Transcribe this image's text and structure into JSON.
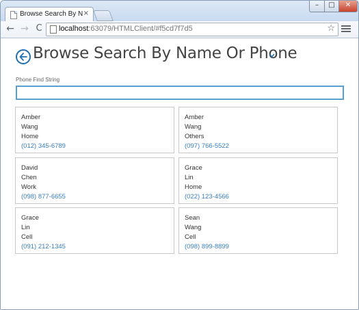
{
  "browser": {
    "tab_title": "Browse Search By Name O",
    "tab_close": "×",
    "url_host": "localhost",
    "url_path": ":63079/HTMLClient/#f5cd7f7d5",
    "window_buttons": {
      "minimize": "–",
      "maximize": "□",
      "close": "✕"
    },
    "icons": [
      "back-arrow-icon",
      "forward-arrow-icon",
      "reload-icon",
      "page-icon",
      "star-icon",
      "menu-icon"
    ]
  },
  "page": {
    "title": "Browse Search By Name Or Phone",
    "accent_color": "#1f6fb2",
    "search": {
      "label": "Phone Find String",
      "value": ""
    },
    "contacts": [
      {
        "first": "Amber",
        "last": "Wang",
        "type": "Home",
        "phone": "(012) 345-6789"
      },
      {
        "first": "Amber",
        "last": "Wang",
        "type": "Others",
        "phone": "(097) 766-5522"
      },
      {
        "first": "David",
        "last": "Chen",
        "type": "Work",
        "phone": "(098) 877-6655"
      },
      {
        "first": "Grace",
        "last": "Lin",
        "type": "Home",
        "phone": "(022) 123-4566"
      },
      {
        "first": "Grace",
        "last": "Lin",
        "type": "Cell",
        "phone": "(091) 212-1345"
      },
      {
        "first": "Sean",
        "last": "Wang",
        "type": "Cell",
        "phone": "(098) 899-8899"
      }
    ]
  }
}
